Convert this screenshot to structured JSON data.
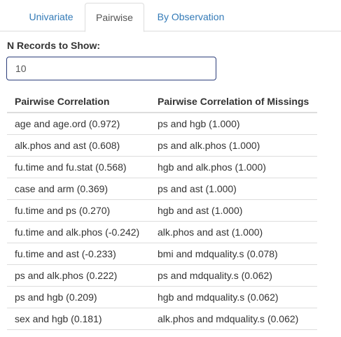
{
  "tabs": [
    {
      "label": "Univariate",
      "active": false
    },
    {
      "label": "Pairwise",
      "active": true
    },
    {
      "label": "By Observation",
      "active": false
    }
  ],
  "n_records": {
    "label": "N Records to Show:",
    "value": "10"
  },
  "table": {
    "headers": [
      "Pairwise Correlation",
      "Pairwise Correlation of Missings"
    ],
    "rows": [
      [
        "age and age.ord (0.972)",
        "ps and hgb (1.000)"
      ],
      [
        "alk.phos and ast (0.608)",
        "ps and alk.phos (1.000)"
      ],
      [
        "fu.time and fu.stat (0.568)",
        "hgb and alk.phos (1.000)"
      ],
      [
        "case and arm (0.369)",
        "ps and ast (1.000)"
      ],
      [
        "fu.time and ps (0.270)",
        "hgb and ast (1.000)"
      ],
      [
        "fu.time and alk.phos (-0.242)",
        "alk.phos and ast (1.000)"
      ],
      [
        "fu.time and ast (-0.233)",
        "bmi and mdquality.s (0.078)"
      ],
      [
        "ps and alk.phos (0.222)",
        "ps and mdquality.s (0.062)"
      ],
      [
        "ps and hgb (0.209)",
        "hgb and mdquality.s (0.062)"
      ],
      [
        "sex and hgb (0.181)",
        "alk.phos and mdquality.s (0.062)"
      ]
    ]
  },
  "colors": {
    "link": "#337ab7",
    "active_tab_text": "#555555",
    "border": "#dddddd",
    "input_border": "#2c3e7a"
  }
}
